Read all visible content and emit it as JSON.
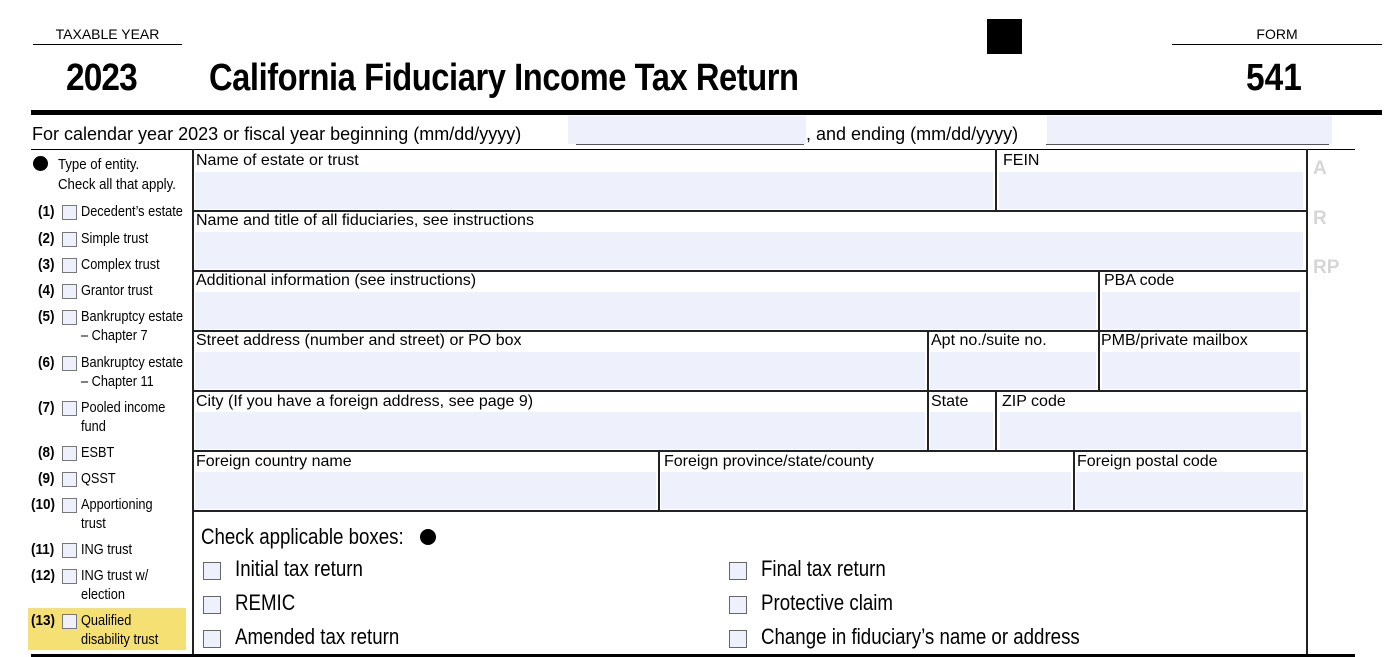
{
  "header": {
    "taxable_year_label": "TAXABLE YEAR",
    "tax_year": "2023",
    "title": "California Fiduciary Income Tax Return",
    "form_label": "FORM",
    "form_number": "541"
  },
  "fiscal_year": {
    "prefix_text": "For calendar year 2023 or fiscal year beginning (mm/dd/yyyy)",
    "begin_value": "",
    "middle_text": ", and ending (mm/dd/yyyy)",
    "end_value": ""
  },
  "entity_type": {
    "heading": "Type of entity.",
    "subheading": "Check all that apply.",
    "items": [
      {
        "num": "(1)",
        "label": "Decedent’s estate",
        "label2": "",
        "checked": false
      },
      {
        "num": "(2)",
        "label": "Simple trust",
        "label2": "",
        "checked": false
      },
      {
        "num": "(3)",
        "label": "Complex trust",
        "label2": "",
        "checked": false
      },
      {
        "num": "(4)",
        "label": "Grantor trust",
        "label2": "",
        "checked": false
      },
      {
        "num": "(5)",
        "label": "Bankruptcy estate",
        "label2": "– Chapter 7",
        "checked": false
      },
      {
        "num": "(6)",
        "label": "Bankruptcy estate",
        "label2": "– Chapter 11",
        "checked": false
      },
      {
        "num": "(7)",
        "label": "Pooled income",
        "label2": "fund",
        "checked": false
      },
      {
        "num": "(8)",
        "label": "ESBT",
        "label2": "",
        "checked": false
      },
      {
        "num": "(9)",
        "label": "QSST",
        "label2": "",
        "checked": false
      },
      {
        "num": "(10)",
        "label": "Apportioning",
        "label2": "trust",
        "checked": false
      },
      {
        "num": "(11)",
        "label": "ING trust",
        "label2": "",
        "checked": false
      },
      {
        "num": "(12)",
        "label": "ING trust w/",
        "label2": "election",
        "checked": false
      },
      {
        "num": "(13)",
        "label": "Qualified",
        "label2": "disability trust",
        "checked": false
      }
    ],
    "highlight_color": "#f5e173"
  },
  "fields": {
    "estate_name": {
      "label": "Name of estate or trust",
      "value": ""
    },
    "fein": {
      "label": "FEIN",
      "value": ""
    },
    "fiduciaries": {
      "label": "Name and title of all fiduciaries, see instructions",
      "value": ""
    },
    "additional_info": {
      "label": "Additional information (see instructions)",
      "value": ""
    },
    "pba_code": {
      "label": "PBA code",
      "value": ""
    },
    "street": {
      "label": "Street address (number and street) or PO box",
      "value": ""
    },
    "apt": {
      "label": "Apt no./suite no.",
      "value": ""
    },
    "pmb": {
      "label": "PMB/private mailbox",
      "value": ""
    },
    "city": {
      "label": "City (If you have a foreign address, see page 9)",
      "value": ""
    },
    "state": {
      "label": "State",
      "value": ""
    },
    "zip": {
      "label": "ZIP code",
      "value": ""
    },
    "foreign_country": {
      "label": "Foreign country name",
      "value": ""
    },
    "foreign_province": {
      "label": "Foreign province/state/county",
      "value": ""
    },
    "foreign_postal": {
      "label": "Foreign postal code",
      "value": ""
    }
  },
  "side_codes": [
    "A",
    "R",
    "RP"
  ],
  "applicable": {
    "heading": "Check applicable boxes:",
    "left": [
      {
        "label": "Initial tax return",
        "checked": false
      },
      {
        "label": "REMIC",
        "checked": false
      },
      {
        "label": "Amended tax return",
        "checked": false
      }
    ],
    "right": [
      {
        "label": "Final tax return",
        "checked": false
      },
      {
        "label": "Protective claim",
        "checked": false
      },
      {
        "label": "Change in fiduciary’s name or address",
        "checked": false
      }
    ]
  },
  "colors": {
    "field_fill": "#eef1fc",
    "side_code_text": "#d6d6d6"
  }
}
